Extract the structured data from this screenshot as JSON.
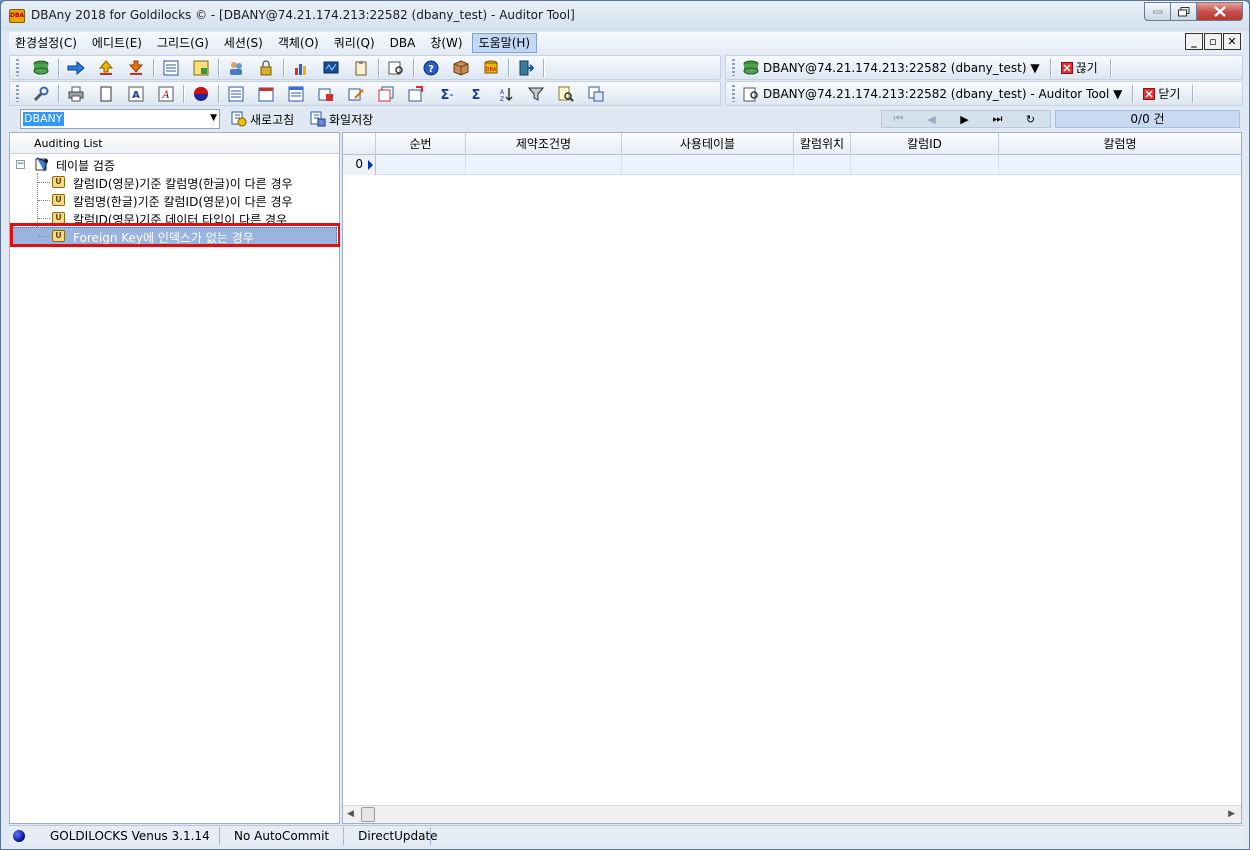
{
  "window": {
    "title": "DBAny 2018 for Goldilocks © - [DBANY@74.21.174.213:22582 (dbany_test) - Auditor Tool]",
    "app_icon_text": "DBA"
  },
  "menu": {
    "items": [
      "환경설정(C)",
      "에디트(E)",
      "그리드(G)",
      "세션(S)",
      "객체(O)",
      "쿼리(Q)",
      "DBA",
      "창(W)",
      "도움말(H)"
    ],
    "active_index": 8
  },
  "toolbar1": {
    "connection": "DBANY@74.21.174.213:22582 (dbany_test) ▼",
    "disconnect_label": "끊기"
  },
  "toolbar2": {
    "window_selector": "DBANY@74.21.174.213:22582 (dbany_test) - Auditor Tool ▼",
    "close_label": "닫기"
  },
  "toolbar3": {
    "schema_value": "DBANY",
    "refresh_label": "새로고침",
    "save_file_label": "화일저장",
    "record_count": "0/0 건",
    "nav": {
      "first": "⏮",
      "prev": "◀",
      "next": "▶",
      "last": "⏭",
      "refresh": "↻"
    }
  },
  "auditing": {
    "header": "Auditing List",
    "root_label": "테이블 검증",
    "expander": "−",
    "item_icon_text": "U",
    "items": [
      "칼럼ID(영문)기준 칼럼명(한글)이 다른 경우",
      "칼럼명(한글)기준 칼럼ID(영문)이 다른 경우",
      "칼럼ID(영문)기준 데이터 타입이 다른 경우",
      "Foreign Key에 인덱스가 없는 경우"
    ],
    "selected_index": 3
  },
  "grid": {
    "columns": [
      "순번",
      "제약조건명",
      "사용테이블",
      "칼럼위치",
      "칼럼ID",
      "칼럼명"
    ],
    "row_number": "0"
  },
  "statusbar": {
    "server": "GOLDILOCKS Venus 3.1.14",
    "commit_mode": "No AutoCommit",
    "update_mode": "DirectUpdate"
  }
}
